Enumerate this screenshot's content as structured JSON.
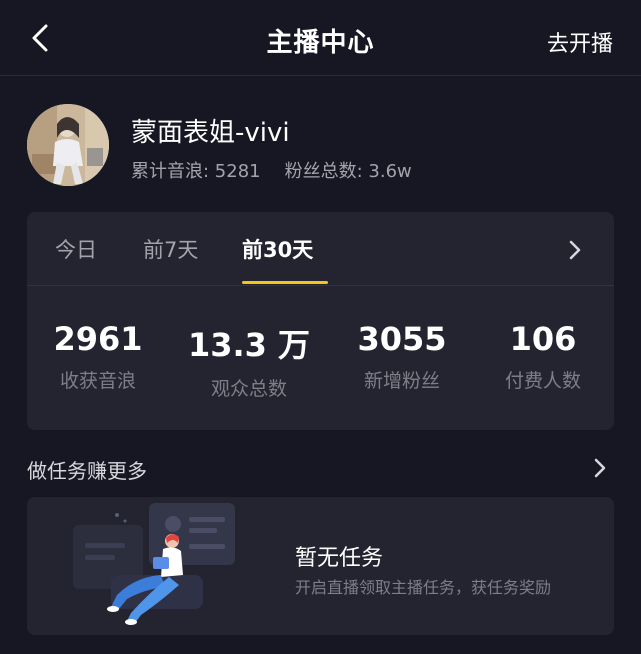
{
  "header": {
    "title": "主播中心",
    "action_label": "去开播"
  },
  "profile": {
    "name": "蒙面表姐-vivi",
    "sound_wave_label": "累计音浪: 5281",
    "fans_label": "粉丝总数: 3.6w"
  },
  "stats": {
    "tabs": [
      {
        "label": "今日",
        "active": false
      },
      {
        "label": "前7天",
        "active": false
      },
      {
        "label": "前30天",
        "active": true
      }
    ],
    "metrics": [
      {
        "value": "2961",
        "label": "收获音浪"
      },
      {
        "value": "13.3 万",
        "label": "观众总数"
      },
      {
        "value": "3055",
        "label": "新增粉丝"
      },
      {
        "value": "106",
        "label": "付费人数"
      }
    ]
  },
  "tasks": {
    "title": "做任务赚更多",
    "empty_title": "暂无任务",
    "empty_subtitle": "开启直播领取主播任务，获任务奖励"
  },
  "colors": {
    "background": "#161722",
    "card": "#23242f",
    "accent": "#f5c518",
    "secondary_text": "#a2a3ab",
    "muted_text": "#7d7e88"
  },
  "icons": {
    "back": "chevron-left-icon",
    "tabs_more": "chevron-right-icon",
    "tasks_more": "chevron-right-icon"
  }
}
